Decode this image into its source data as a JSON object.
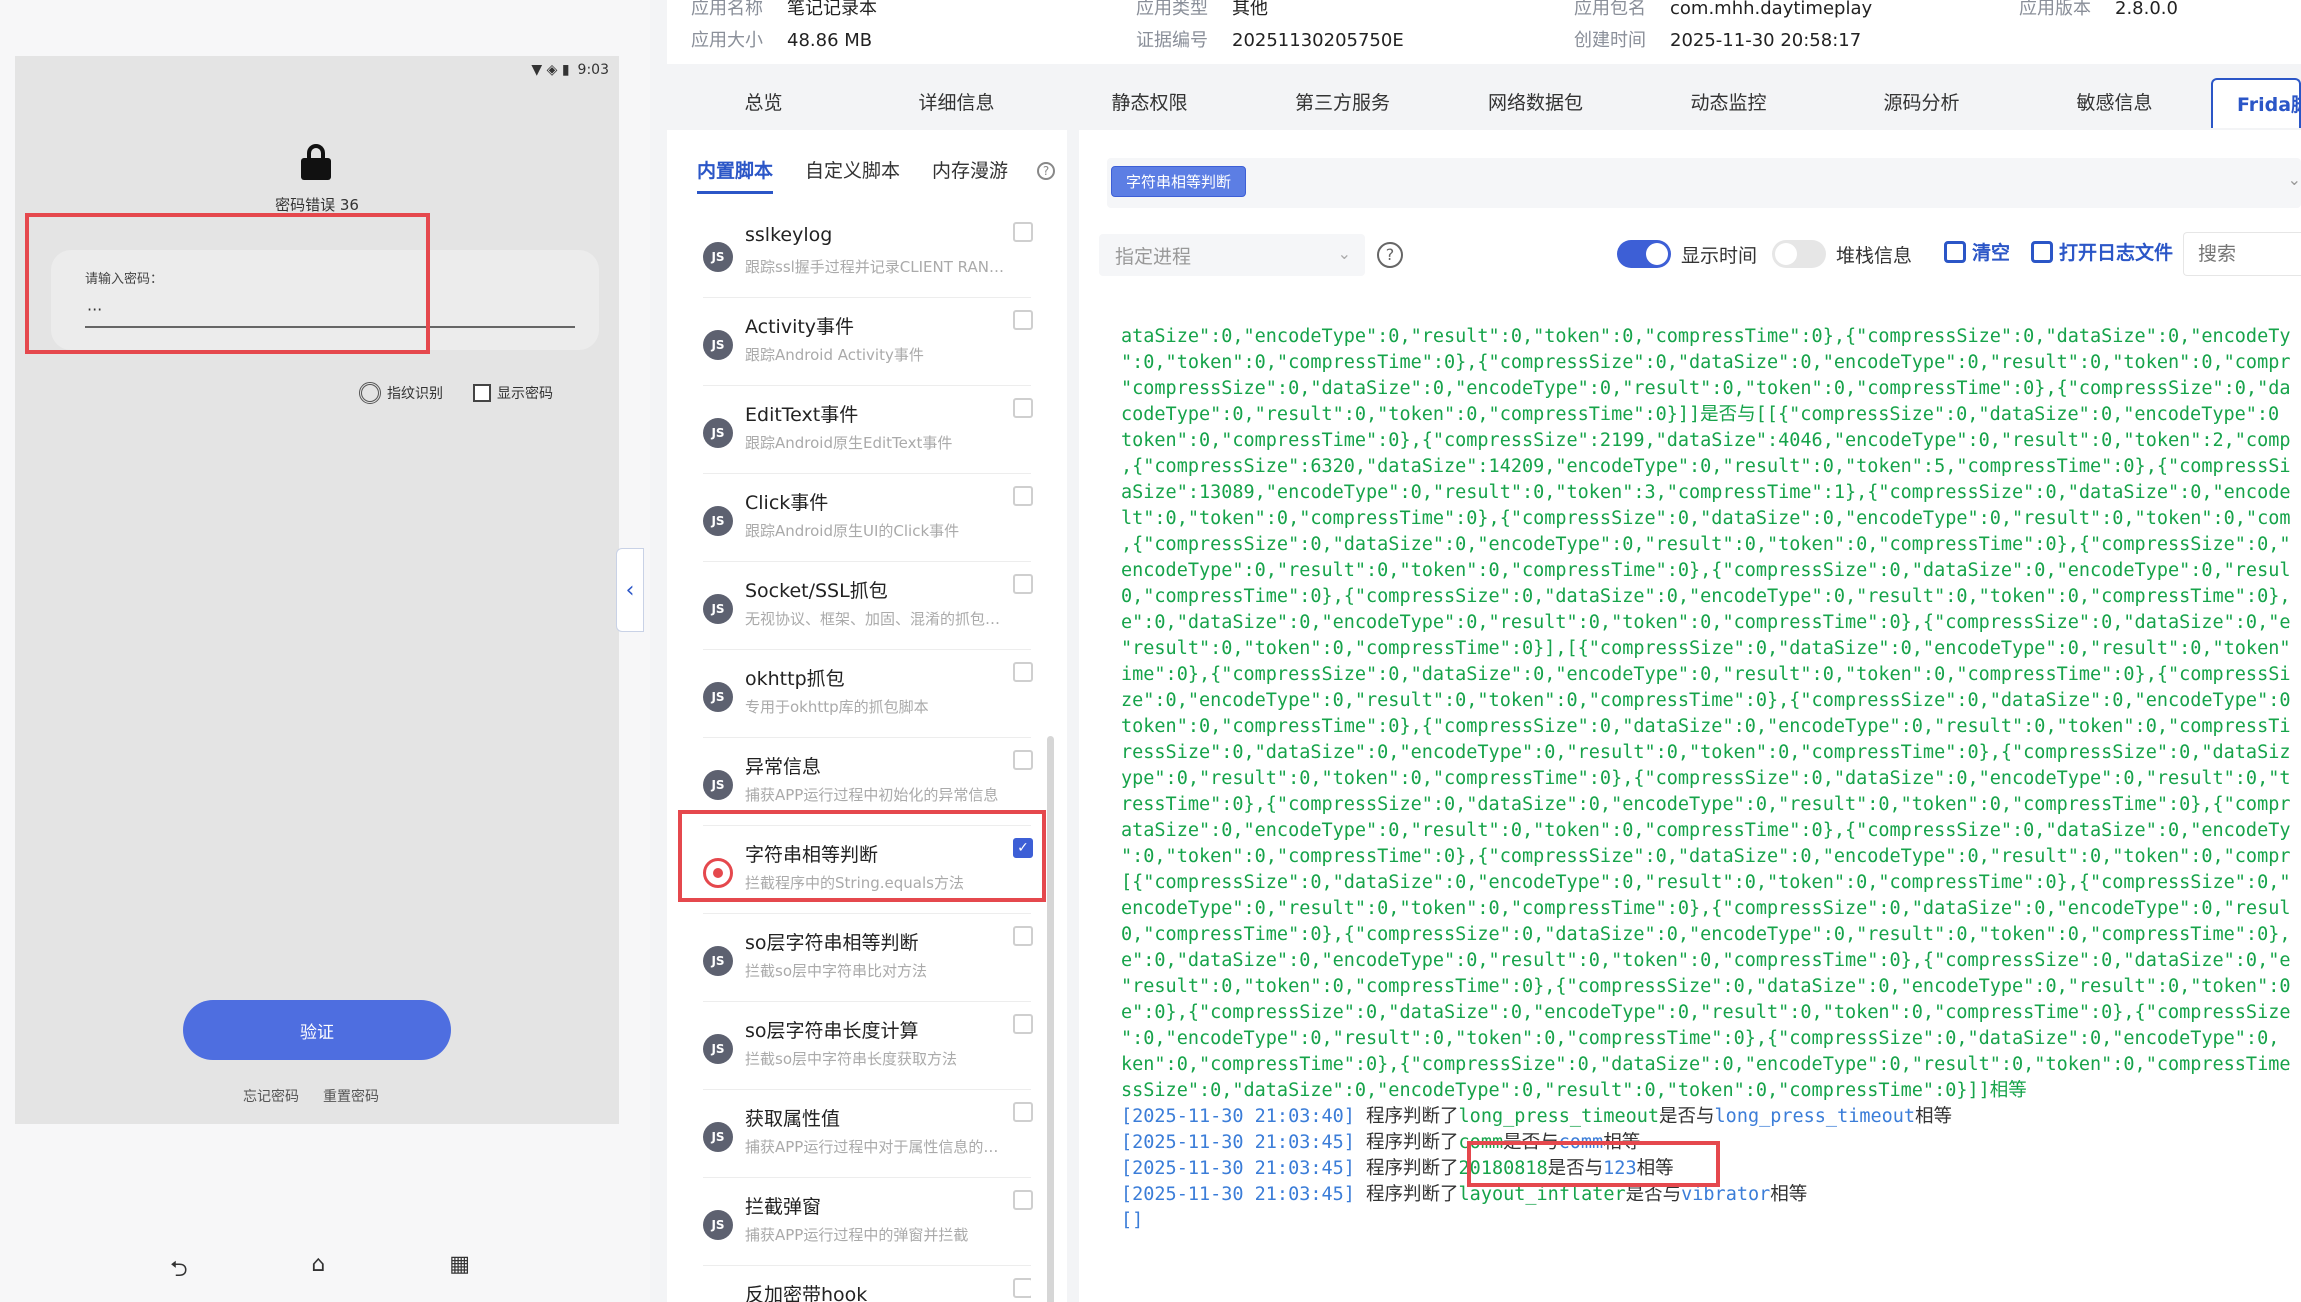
{
  "emulator": {
    "status_time": "9:03",
    "status_icons": "▼ ◈ ▮",
    "pwd_error": "密码错误 36",
    "input_label": "请输入密码：",
    "input_value": "···",
    "fingerprint_label": "指纹识别",
    "show_pwd_label": "显示密码",
    "verify_label": "验证",
    "forgot_label": "忘记密码",
    "reset_label": "重置密码",
    "nav_back": "⮌",
    "nav_home": "⌂",
    "nav_recent": "▦",
    "collapse": "‹"
  },
  "header": {
    "app_name_key": "应用名称",
    "app_name": "笔记记录本",
    "app_size_key": "应用大小",
    "app_size": "48.86 MB",
    "app_type_key": "应用类型",
    "app_type": "其他",
    "cert_key": "证据编号",
    "cert": "20251130205750E",
    "pkg_key": "应用包名",
    "pkg": "com.mhh.daytimeplay",
    "created_key": "创建时间",
    "created": "2025-11-30 20:58:17",
    "ver_key": "应用版本",
    "ver": "2.8.0.0"
  },
  "tabs": [
    "总览",
    "详细信息",
    "静态权限",
    "第三方服务",
    "网络数据包",
    "动态监控",
    "源码分析",
    "敏感信息",
    "Frida脚本"
  ],
  "script_list": {
    "subtabs": [
      "内置脚本",
      "自定义脚本",
      "内存漫游"
    ],
    "help": "?",
    "badge": "JS",
    "check_mark": "✓",
    "items": [
      {
        "title": "sslkeylog",
        "sub": "跟踪ssl握手过程并记录CLIENT RANDOM"
      },
      {
        "title": "Activity事件",
        "sub": "跟踪Android Activity事件"
      },
      {
        "title": "EditText事件",
        "sub": "跟踪Android原生EditText事件"
      },
      {
        "title": "Click事件",
        "sub": "跟踪Android原生UI的Click事件"
      },
      {
        "title": "Socket/SSL抓包",
        "sub": "无视协议、框架、加固、混淆的抓包脚本"
      },
      {
        "title": "okhttp抓包",
        "sub": "专用于okhttp库的抓包脚本"
      },
      {
        "title": "异常信息",
        "sub": "捕获APP运行过程中初始化的异常信息"
      },
      {
        "title": "字符串相等判断",
        "sub": "拦截程序中的String.equals方法"
      },
      {
        "title": "so层字符串相等判断",
        "sub": "拦截so层中字符串比对方法"
      },
      {
        "title": "so层字符串长度计算",
        "sub": "拦截so层中字符串长度获取方法"
      },
      {
        "title": "获取属性值",
        "sub": "捕获APP运行过程中对于属性信息的获取"
      },
      {
        "title": "拦截弹窗",
        "sub": "捕获APP运行过程中的弹窗并拦截"
      },
      {
        "title": "反加密带hook",
        "sub": ""
      }
    ]
  },
  "log_panel": {
    "active_hook": "字符串相等判断",
    "chevron": "⌄",
    "proc_placeholder": "指定进程",
    "proc_caret": "⌄",
    "help": "?",
    "show_time": "显示时间",
    "stack_info": "堆栈信息",
    "clear": "清空",
    "open_log": "打开日志文件",
    "search_placeholder": "搜索",
    "json_lines": [
      "ataSize\":0,\"encodeType\":0,\"result\":0,\"token\":0,\"compressTime\":0},{\"compressSize\":0,\"dataSize\":0,\"encodeTy",
      "\":0,\"token\":0,\"compressTime\":0},{\"compressSize\":0,\"dataSize\":0,\"encodeType\":0,\"result\":0,\"token\":0,\"compr",
      "\"compressSize\":0,\"dataSize\":0,\"encodeType\":0,\"result\":0,\"token\":0,\"compressTime\":0},{\"compressSize\":0,\"da",
      "codeType\":0,\"result\":0,\"token\":0,\"compressTime\":0}]]是否与[[{\"compressSize\":0,\"dataSize\":0,\"encodeType\":0",
      "token\":0,\"compressTime\":0},{\"compressSize\":2199,\"dataSize\":4046,\"encodeType\":0,\"result\":0,\"token\":2,\"comp",
      ",{\"compressSize\":6320,\"dataSize\":14209,\"encodeType\":0,\"result\":0,\"token\":5,\"compressTime\":0},{\"compressSi",
      "aSize\":13089,\"encodeType\":0,\"result\":0,\"token\":3,\"compressTime\":1},{\"compressSize\":0,\"dataSize\":0,\"encode",
      "lt\":0,\"token\":0,\"compressTime\":0},{\"compressSize\":0,\"dataSize\":0,\"encodeType\":0,\"result\":0,\"token\":0,\"com",
      ",{\"compressSize\":0,\"dataSize\":0,\"encodeType\":0,\"result\":0,\"token\":0,\"compressTime\":0},{\"compressSize\":0,\"",
      "encodeType\":0,\"result\":0,\"token\":0,\"compressTime\":0},{\"compressSize\":0,\"dataSize\":0,\"encodeType\":0,\"resul",
      "0,\"compressTime\":0},{\"compressSize\":0,\"dataSize\":0,\"encodeType\":0,\"result\":0,\"token\":0,\"compressTime\":0},",
      "e\":0,\"dataSize\":0,\"encodeType\":0,\"result\":0,\"token\":0,\"compressTime\":0},{\"compressSize\":0,\"dataSize\":0,\"e",
      "\"result\":0,\"token\":0,\"compressTime\":0}],[{\"compressSize\":0,\"dataSize\":0,\"encodeType\":0,\"result\":0,\"token\"",
      "ime\":0},{\"compressSize\":0,\"dataSize\":0,\"encodeType\":0,\"result\":0,\"token\":0,\"compressTime\":0},{\"compressSi",
      "ze\":0,\"encodeType\":0,\"result\":0,\"token\":0,\"compressTime\":0},{\"compressSize\":0,\"dataSize\":0,\"encodeType\":0",
      "token\":0,\"compressTime\":0},{\"compressSize\":0,\"dataSize\":0,\"encodeType\":0,\"result\":0,\"token\":0,\"compressTi",
      "ressSize\":0,\"dataSize\":0,\"encodeType\":0,\"result\":0,\"token\":0,\"compressTime\":0},{\"compressSize\":0,\"dataSiz",
      "ype\":0,\"result\":0,\"token\":0,\"compressTime\":0},{\"compressSize\":0,\"dataSize\":0,\"encodeType\":0,\"result\":0,\"t",
      "ressTime\":0},{\"compressSize\":0,\"dataSize\":0,\"encodeType\":0,\"result\":0,\"token\":0,\"compressTime\":0},{\"compr",
      "ataSize\":0,\"encodeType\":0,\"result\":0,\"token\":0,\"compressTime\":0},{\"compressSize\":0,\"dataSize\":0,\"encodeTy",
      "\":0,\"token\":0,\"compressTime\":0},{\"compressSize\":0,\"dataSize\":0,\"encodeType\":0,\"result\":0,\"token\":0,\"compr",
      "[{\"compressSize\":0,\"dataSize\":0,\"encodeType\":0,\"result\":0,\"token\":0,\"compressTime\":0},{\"compressSize\":0,\"",
      "encodeType\":0,\"result\":0,\"token\":0,\"compressTime\":0},{\"compressSize\":0,\"dataSize\":0,\"encodeType\":0,\"resul",
      "0,\"compressTime\":0},{\"compressSize\":0,\"dataSize\":0,\"encodeType\":0,\"result\":0,\"token\":0,\"compressTime\":0},",
      "e\":0,\"dataSize\":0,\"encodeType\":0,\"result\":0,\"token\":0,\"compressTime\":0},{\"compressSize\":0,\"dataSize\":0,\"e",
      "\"result\":0,\"token\":0,\"compressTime\":0},{\"compressSize\":0,\"dataSize\":0,\"encodeType\":0,\"result\":0,\"token\":0",
      "e\":0},{\"compressSize\":0,\"dataSize\":0,\"encodeType\":0,\"result\":0,\"token\":0,\"compressTime\":0},{\"compressSize",
      "\":0,\"encodeType\":0,\"result\":0,\"token\":0,\"compressTime\":0},{\"compressSize\":0,\"dataSize\":0,\"encodeType\":0,",
      "ken\":0,\"compressTime\":0},{\"compressSize\":0,\"dataSize\":0,\"encodeType\":0,\"result\":0,\"token\":0,\"compressTime",
      "ssSize\":0,\"dataSize\":0,\"encodeType\":0,\"result\":0,\"token\":0,\"compressTime\":0}]]相等"
    ],
    "events": [
      {
        "ts": "[2025-11-30 21:03:40]",
        "pre": " 程序判断了",
        "a": "long_press_timeout",
        "mid": "是否与",
        "b": "long_press_timeout",
        "end": "相等"
      },
      {
        "ts": "[2025-11-30 21:03:45]",
        "pre": " 程序判断了",
        "a": "comm",
        "mid": "是否与",
        "b": "comm",
        "end": "相等"
      },
      {
        "ts": "[2025-11-30 21:03:45]",
        "pre": " 程序判断了",
        "a": "20180818",
        "mid": "是否与",
        "b": "123",
        "end": "相等"
      },
      {
        "ts": "[2025-11-30 21:03:45]",
        "pre": " 程序判断了",
        "a": "layout_inflater",
        "mid": "是否与",
        "b": "vibrator",
        "end": "相等"
      }
    ],
    "cursor": "[]"
  },
  "colors": {
    "accent": "#2b56c7",
    "highlight_red": "#e5484d",
    "log_green": "#16a34a",
    "log_blue": "#3b7dd8"
  }
}
